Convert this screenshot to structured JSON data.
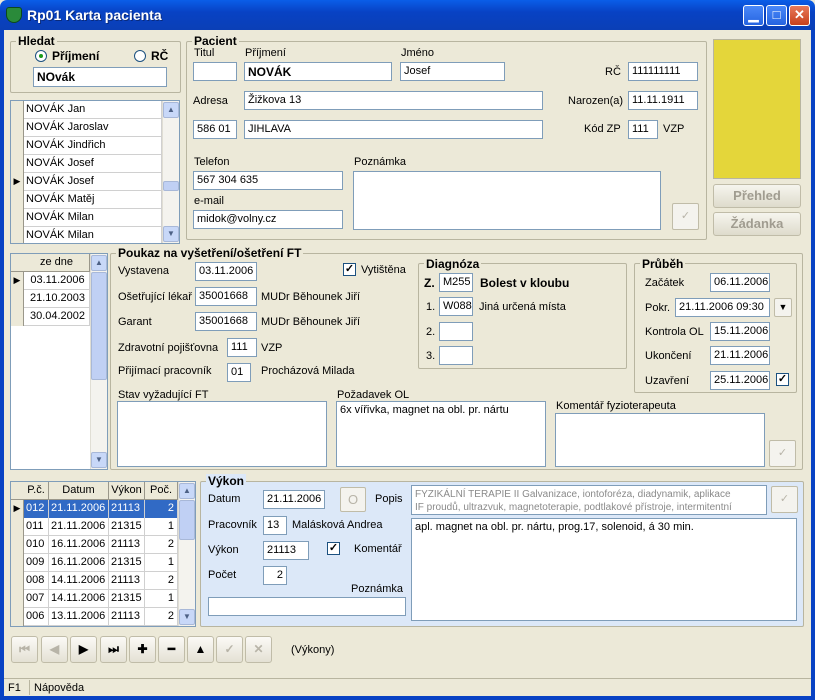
{
  "window": {
    "title": "Rp01 Karta pacienta"
  },
  "hledat": {
    "title": "Hledat",
    "radio_prijmeni": "Příjmení",
    "radio_rc": "RČ",
    "search_value": "NOvák"
  },
  "patient_list": [
    "NOVÁK Jan",
    "NOVÁK Jaroslav",
    "NOVÁK Jindřich",
    "NOVÁK Josef",
    "NOVÁK Josef",
    "NOVÁK Matěj",
    "NOVÁK Milan",
    "NOVÁK Milan"
  ],
  "patient_selected_index": 4,
  "pacient": {
    "title": "Pacient",
    "label_titul": "Titul",
    "titul": "",
    "label_prijmeni": "Příjmení",
    "prijmeni": "NOVÁK",
    "label_jmeno": "Jméno",
    "jmeno": "Josef",
    "label_rc": "RČ",
    "rc": "111111111",
    "label_adresa": "Adresa",
    "adresa": "Žižkova 13",
    "label_narozen": "Narozen(a)",
    "narozen": "11.11.1911",
    "psc": "586 01",
    "mesto": "JIHLAVA",
    "label_kodzp": "Kód ZP",
    "kodzp": "111",
    "kodzp_name": "VZP",
    "label_telefon": "Telefon",
    "telefon": "567 304 635",
    "label_email": "e-mail",
    "email": "midok@volny.cz",
    "label_poznamka": "Poznámka",
    "poznamka": ""
  },
  "side_buttons": {
    "prehled": "Přehled",
    "zadanka": "Žádanka",
    "photo_color": "#e4d63a"
  },
  "dates_list": {
    "header": "ze dne",
    "rows": [
      "03.11.2006",
      "21.10.2003",
      "30.04.2002"
    ],
    "selected_index": 0
  },
  "poukaz": {
    "title": "Poukaz na vyšetření/ošetření FT",
    "label_vystavena": "Vystavena",
    "vystavena": "03.11.2006",
    "vytistena_label": "Vytištěna",
    "vytistena": true,
    "label_lekar": "Ošetřující lékař",
    "lekar_kod": "35001668",
    "lekar_jmeno": "MUDr Běhounek Jiří",
    "label_garant": "Garant",
    "garant_kod": "35001668",
    "garant_jmeno": "MUDr Běhounek Jiří",
    "label_pojistovna": "Zdravotní pojišťovna",
    "pojistovna_kod": "111",
    "pojistovna_name": "VZP",
    "label_prijimaci": "Přijímací pracovník",
    "prijimaci_kod": "01",
    "prijimaci_jmeno": "Procházová Milada",
    "label_stav": "Stav vyžadující FT",
    "stav": "",
    "label_pozadavek": "Požadavek OL",
    "pozadavek": "6x vířivka, magnet na obl. pr. nártu",
    "label_komentar": "Komentář fyzioterapeuta",
    "komentar": ""
  },
  "diagnoza": {
    "title": "Diagnóza",
    "z_label": "Z.",
    "z_code": "M255",
    "z_text": "Bolest v kloubu",
    "d1_label": "1.",
    "d1_code": "W088",
    "d1_text": "Jiná určená místa",
    "d2_label": "2.",
    "d3_label": "3."
  },
  "prubeh": {
    "title": "Průběh",
    "label_zacatek": "Začátek",
    "zacatek": "06.11.2006",
    "label_pokr": "Pokr.",
    "pokr": "21.11.2006  09:30",
    "label_kontrola": "Kontrola OL",
    "kontrola": "15.11.2006",
    "label_ukonceni": "Ukončení",
    "ukonceni": "21.11.2006",
    "label_uzavreni": "Uzavření",
    "uzavreni": "25.11.2006",
    "uzavreni_checked": true
  },
  "vykony_table": {
    "headers": [
      "P.č.",
      "Datum",
      "Výkon",
      "Poč."
    ],
    "rows": [
      [
        "012",
        "21.11.2006",
        "21113",
        "2"
      ],
      [
        "011",
        "21.11.2006",
        "21315",
        "1"
      ],
      [
        "010",
        "16.11.2006",
        "21113",
        "2"
      ],
      [
        "009",
        "16.11.2006",
        "21315",
        "1"
      ],
      [
        "008",
        "14.11.2006",
        "21113",
        "2"
      ],
      [
        "007",
        "14.11.2006",
        "21315",
        "1"
      ],
      [
        "006",
        "13.11.2006",
        "21113",
        "2"
      ]
    ],
    "selected_index": 0
  },
  "vykon": {
    "title": "Výkon",
    "label_datum": "Datum",
    "datum": "21.11.2006",
    "o_button": "O",
    "label_popis": "Popis",
    "popis_line1": "FYZIKÁLNÍ TERAPIE II  Galvanizace, iontoforéza, diadynamik,   aplikace",
    "popis_line2": "IF proudů, ultrazvuk, magnetoterapie, podtlakové    přístroje, intermitentní",
    "label_pracovnik": "Pracovník",
    "pracovnik_kod": "13",
    "pracovnik_jmeno": "Malásková Andrea",
    "label_vykon": "Výkon",
    "vykon_kod": "21113",
    "komentar_label": "Komentář",
    "komentar_checked": true,
    "label_pocet": "Počet",
    "pocet": "2",
    "label_poznamka": "Poznámka",
    "poznamka": "",
    "komentar_text": "apl. magnet na obl. pr. nártu, prog.17, solenoid, á 30 min."
  },
  "navigator": {
    "context_label": "(Výkony)"
  },
  "status": {
    "key": "F1",
    "text": "Nápověda"
  }
}
